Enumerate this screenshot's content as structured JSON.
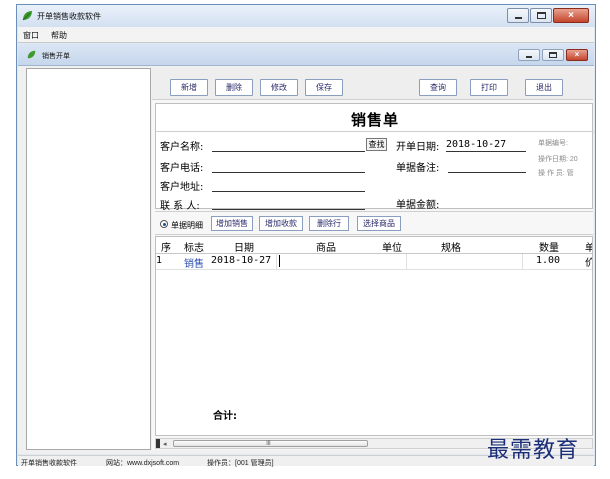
{
  "app": {
    "title": "开单销售收款软件",
    "menu": [
      "窗口",
      "帮助"
    ]
  },
  "child_window": {
    "title": "销售开单"
  },
  "toolbar": {
    "new": "新增",
    "delete": "删除",
    "edit": "修改",
    "save": "保存",
    "query": "查询",
    "print": "打印",
    "exit": "退出"
  },
  "form": {
    "doc_title": "销售单",
    "customer_name_label": "客户名称:",
    "find_button": "查找",
    "open_date_label": "开单日期:",
    "open_date_value": "2018-10-27",
    "phone_label": "客户电话:",
    "remark_label": "单据备注:",
    "address_label": "客户地址:",
    "contact_label": "联 系 人:",
    "amount_label": "单据金额:",
    "side": {
      "doc_no": "单据编号:",
      "op_date": "操作日期: 20",
      "operator": "操 作 员: 管"
    }
  },
  "detail_bar": {
    "radio_label": "单据明细",
    "buttons": [
      "增加销售",
      "增加收款",
      "删除行",
      "选择商品"
    ]
  },
  "grid": {
    "columns": [
      "序",
      "标志",
      "日期",
      "商品",
      "单位",
      "规格",
      "数量",
      "单价"
    ],
    "rows": [
      {
        "seq": "1",
        "flag": "销售",
        "date": "2018-10-27",
        "product": "",
        "unit": "",
        "spec": "",
        "qty": "1.00",
        "price": ""
      }
    ],
    "total_label": "合计:"
  },
  "scroll": {
    "left_arrow": "◂",
    "grip": "Ⅲ"
  },
  "status": {
    "app": "开单销售收款软件",
    "site": "网站：www.dxjsoft.com",
    "operator": "操作员：[001 管理员]"
  },
  "watermark": "最需教育",
  "colors": {
    "accent": "#2a2a6a",
    "flag_text": "#2c4fb0",
    "watermark": "#1b2e78"
  }
}
